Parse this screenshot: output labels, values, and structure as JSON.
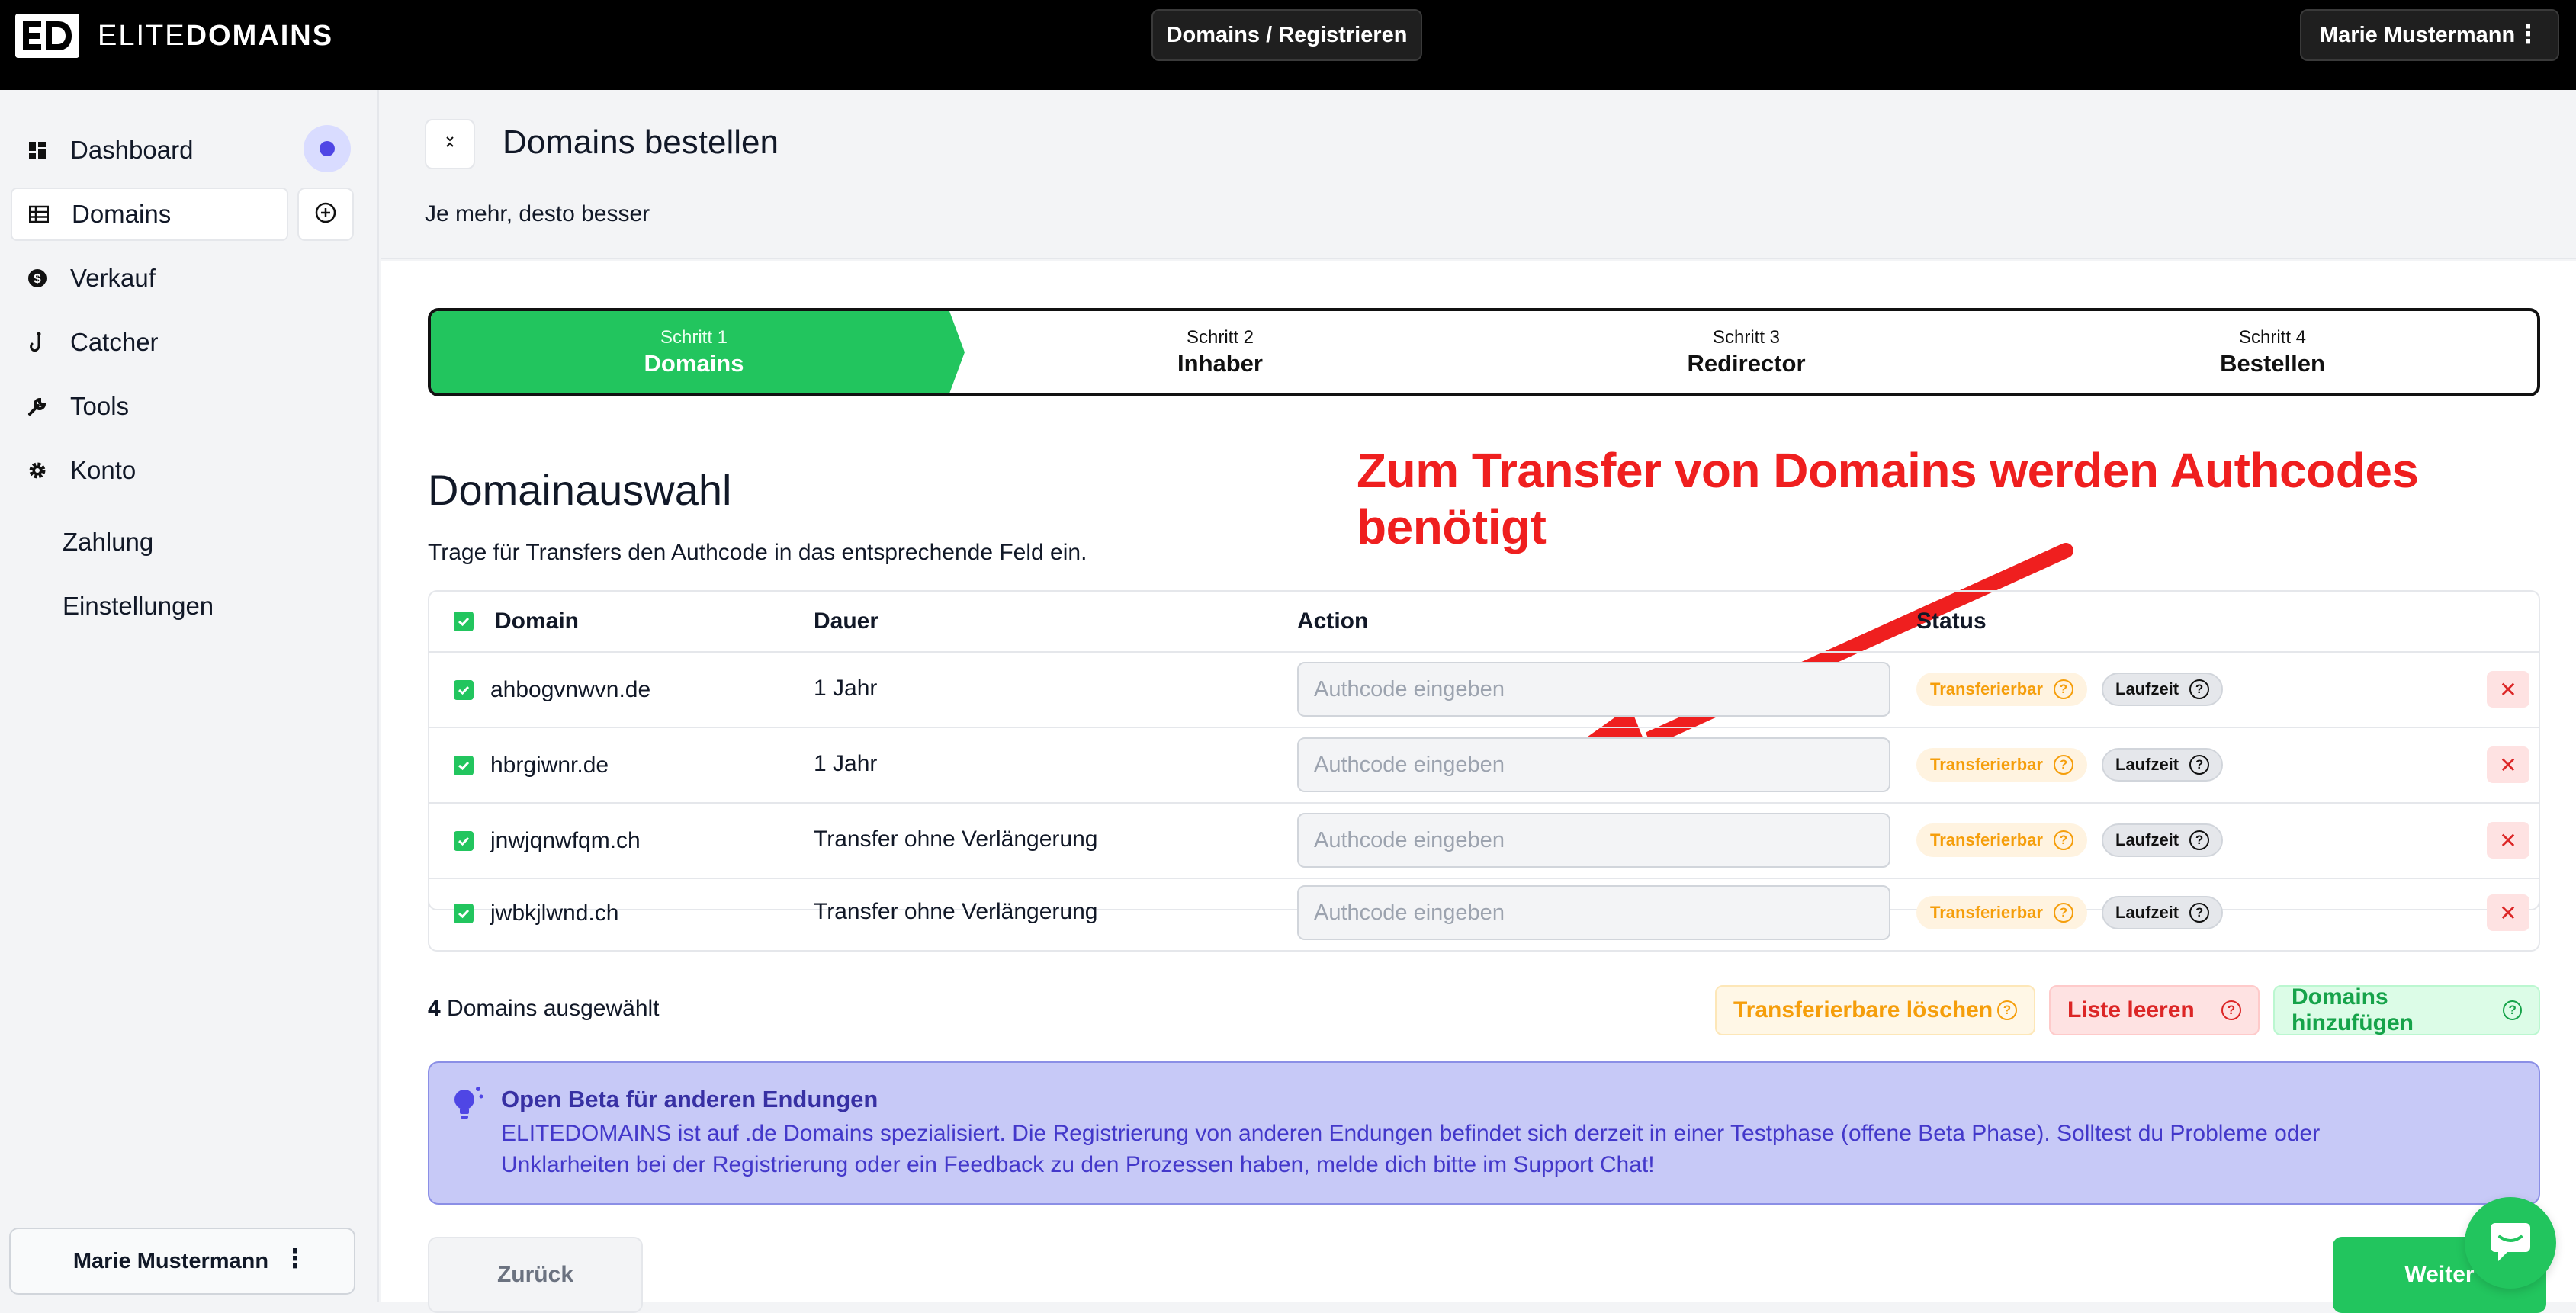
{
  "brand": {
    "name_light": "ELITE",
    "name_bold": "DOMAINS"
  },
  "topbar": {
    "breadcrumb": "Domains / Registrieren",
    "user_name": "Marie Mustermann"
  },
  "sidebar": {
    "items": [
      {
        "label": "Dashboard",
        "icon": "dashboard-icon"
      },
      {
        "label": "Domains",
        "icon": "table-icon"
      },
      {
        "label": "Verkauf",
        "icon": "dollar-icon"
      },
      {
        "label": "Catcher",
        "icon": "hook-icon"
      },
      {
        "label": "Tools",
        "icon": "wrench-icon"
      },
      {
        "label": "Konto",
        "icon": "gear-icon"
      }
    ],
    "sub_items": [
      {
        "label": "Zahlung"
      },
      {
        "label": "Einstellungen"
      }
    ],
    "user_name": "Marie Mustermann"
  },
  "header": {
    "title": "Domains bestellen",
    "subtitle": "Je mehr, desto besser"
  },
  "steps": [
    {
      "num": "Schritt 1",
      "name": "Domains",
      "active": true
    },
    {
      "num": "Schritt 2",
      "name": "Inhaber",
      "active": false
    },
    {
      "num": "Schritt 3",
      "name": "Redirector",
      "active": false
    },
    {
      "num": "Schritt 4",
      "name": "Bestellen",
      "active": false
    }
  ],
  "annotation": "Zum Transfer von Domains werden Authcodes benötigt",
  "section": {
    "title": "Domainauswahl",
    "description": "Trage für Transfers den Authcode in das entsprechende Feld ein."
  },
  "table": {
    "columns": {
      "domain": "Domain",
      "duration": "Dauer",
      "action": "Action",
      "status": "Status"
    },
    "rows": [
      {
        "domain": "ahbogvnwvn.de",
        "duration": "1 Jahr",
        "authcode": "",
        "placeholder": "Authcode eingeben",
        "status": "Transferierbar",
        "runtime": "Laufzeit"
      },
      {
        "domain": "hbrgiwnr.de",
        "duration": "1 Jahr",
        "authcode": "",
        "placeholder": "Authcode eingeben",
        "status": "Transferierbar",
        "runtime": "Laufzeit"
      },
      {
        "domain": "jnwjqnwfqm.ch",
        "duration": "Transfer ohne Verlängerung",
        "authcode": "",
        "placeholder": "Authcode eingeben",
        "status": "Transferierbar",
        "runtime": "Laufzeit"
      },
      {
        "domain": "jwbkjlwnd.ch",
        "duration": "Transfer ohne Verlängerung",
        "authcode": "",
        "placeholder": "Authcode eingeben",
        "status": "Transferierbar",
        "runtime": "Laufzeit"
      }
    ]
  },
  "selection": {
    "count": "4",
    "label": "Domains ausgewählt"
  },
  "actions": {
    "delete_transferable": "Transferierbare löschen",
    "clear_list": "Liste leeren",
    "add_domains": "Domains hinzufügen"
  },
  "info": {
    "title": "Open Beta für anderen Endungen",
    "text": "ELITEDOMAINS ist auf .de Domains spezialisiert. Die Registrierung von anderen Endungen befindet sich derzeit in einer Testphase (offene Beta Phase). Solltest du Probleme oder Unklarheiten bei der Registrierung oder ein Feedback zu den Prozessen haben, melde dich bitte im Support Chat!"
  },
  "footer": {
    "back_label": "Zurück",
    "next_label": "Weiter"
  },
  "colors": {
    "accent": "#22c55e",
    "annotation": "#ef1f1f",
    "info_bg": "#c7c9f7",
    "warning": "#f59e0b",
    "danger": "#dc2626"
  }
}
